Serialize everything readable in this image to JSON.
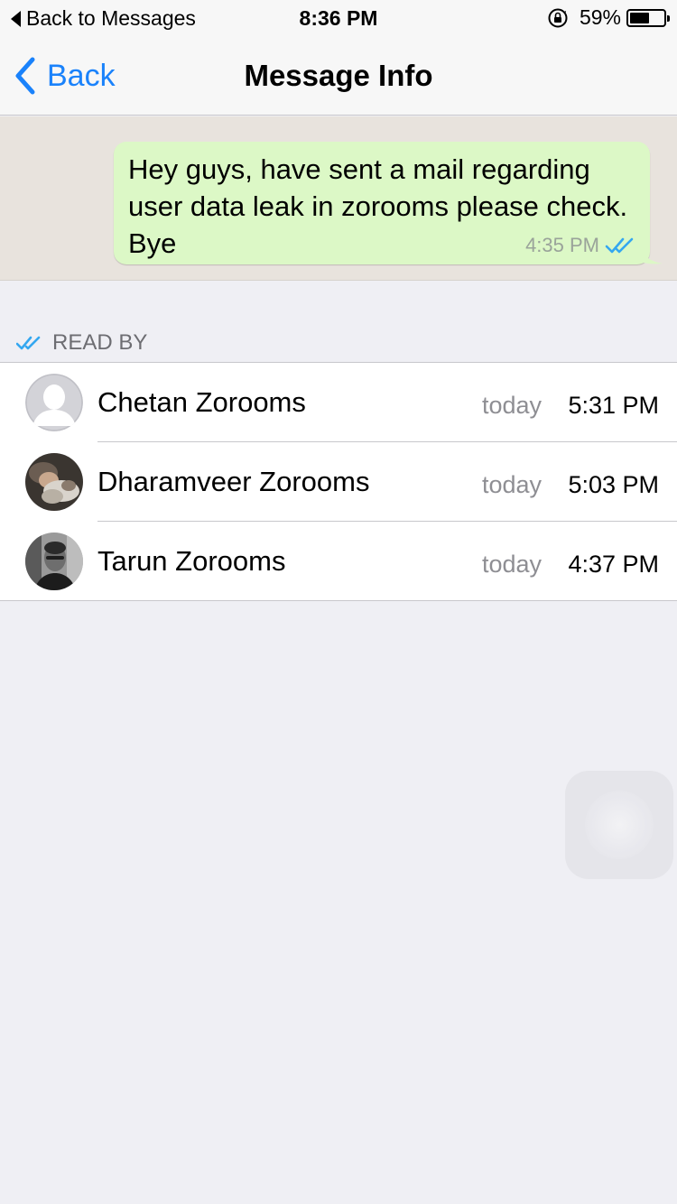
{
  "status_bar": {
    "back_label": "Back to Messages",
    "time": "8:36 PM",
    "battery_percent_label": "59%",
    "battery_level": 0.59
  },
  "nav": {
    "back_label": "Back",
    "title": "Message Info"
  },
  "message": {
    "text": "Hey guys, have sent a mail regarding user data leak in zorooms please check. Bye",
    "time": "4:35 PM",
    "status_icon": "double-check-icon",
    "bubble_color": "#dcf8c6"
  },
  "read_by": {
    "header": "READ BY",
    "icon": "double-check-icon",
    "accent": "#34a7f0",
    "rows": [
      {
        "name": "Chetan Zorooms",
        "day": "today",
        "time": "5:31 PM",
        "avatar": "default-avatar-icon"
      },
      {
        "name": "Dharamveer Zorooms",
        "day": "today",
        "time": "5:03 PM",
        "avatar": "photo-avatar"
      },
      {
        "name": "Tarun Zorooms",
        "day": "today",
        "time": "4:37 PM",
        "avatar": "photo-avatar"
      }
    ]
  },
  "colors": {
    "ios_blue": "#1a82fb",
    "background": "#efeff4",
    "chat_background": "#e8e3dd"
  }
}
